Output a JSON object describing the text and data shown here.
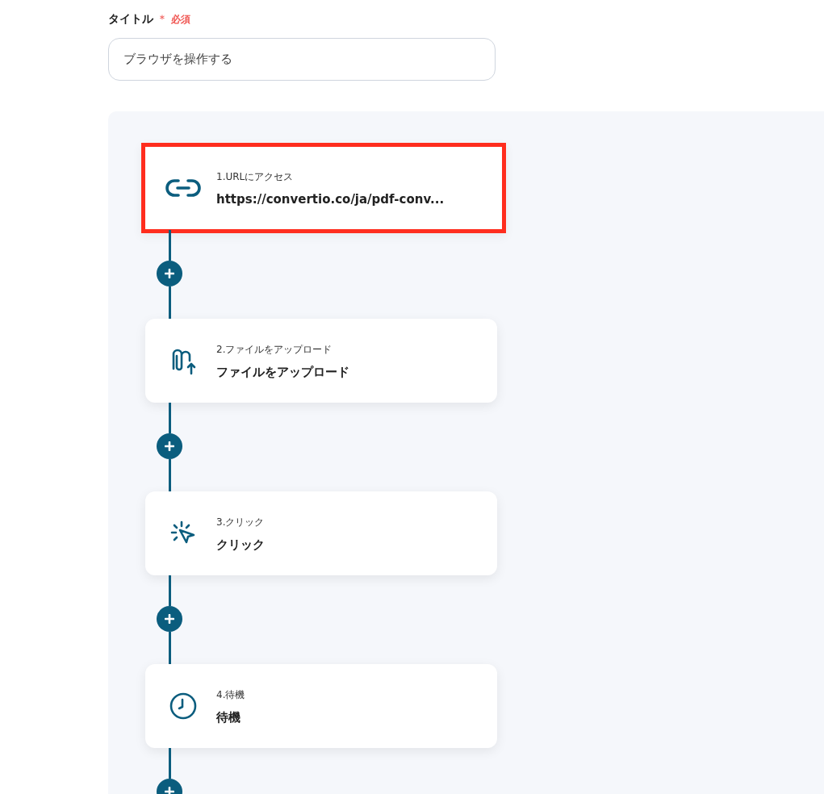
{
  "title_field": {
    "label": "タイトル",
    "required_mark": "＊",
    "required_text": "必須",
    "value": "ブラウザを操作する"
  },
  "steps": [
    {
      "kind": "link",
      "label": "1.URLにアクセス",
      "value": "https://convertio.co/ja/pdf-conv...",
      "highlighted": true
    },
    {
      "kind": "upload",
      "label": "2.ファイルをアップロード",
      "value": "ファイルをアップロード",
      "highlighted": false
    },
    {
      "kind": "click",
      "label": "3.クリック",
      "value": "クリック",
      "highlighted": false
    },
    {
      "kind": "wait",
      "label": "4.待機",
      "value": "待機",
      "highlighted": false
    }
  ]
}
